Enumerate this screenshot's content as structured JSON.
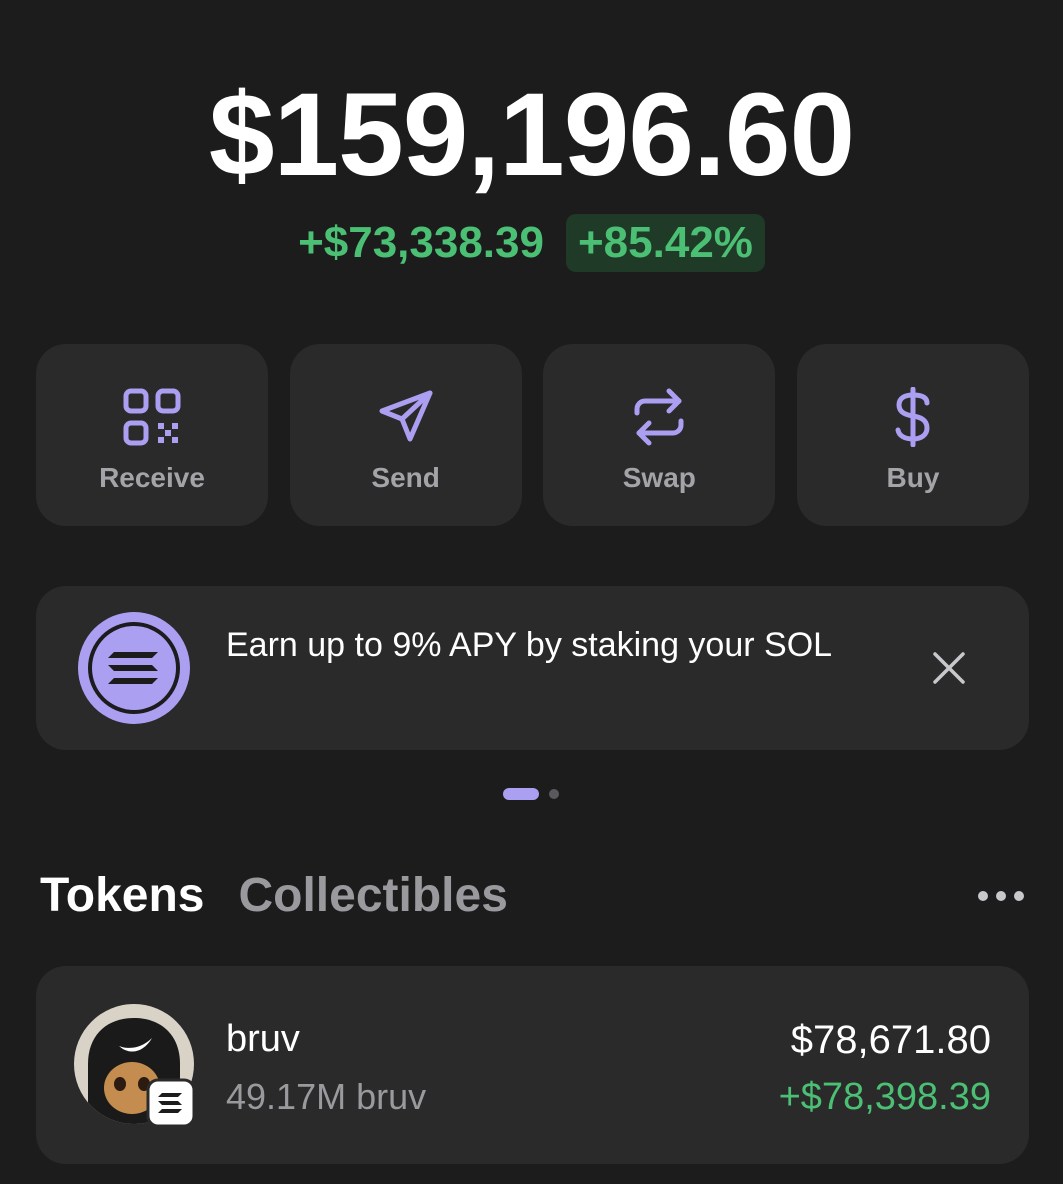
{
  "portfolio": {
    "balance": "$159,196.60",
    "change_amount": "+$73,338.39",
    "change_percent": "+85.42%"
  },
  "actions": [
    {
      "label": "Receive",
      "icon": "qr-code-icon"
    },
    {
      "label": "Send",
      "icon": "send-icon"
    },
    {
      "label": "Swap",
      "icon": "swap-icon"
    },
    {
      "label": "Buy",
      "icon": "dollar-icon"
    }
  ],
  "banner": {
    "text": "Earn up to 9% APY by staking your SOL",
    "icon": "solana-icon",
    "close_icon": "close-icon"
  },
  "carousel": {
    "pages": 2,
    "active": 1
  },
  "tabs": [
    "Tokens",
    "Collectibles"
  ],
  "active_tab": "Tokens",
  "tokens": [
    {
      "name": "bruv",
      "quantity": "49.17M bruv",
      "value": "$78,671.80",
      "change": "+$78,398.39"
    }
  ],
  "colors": {
    "accent": "#ab9ff2",
    "positive": "#4bbf73",
    "background": "#1c1c1d",
    "card": "#2a2a2b"
  }
}
